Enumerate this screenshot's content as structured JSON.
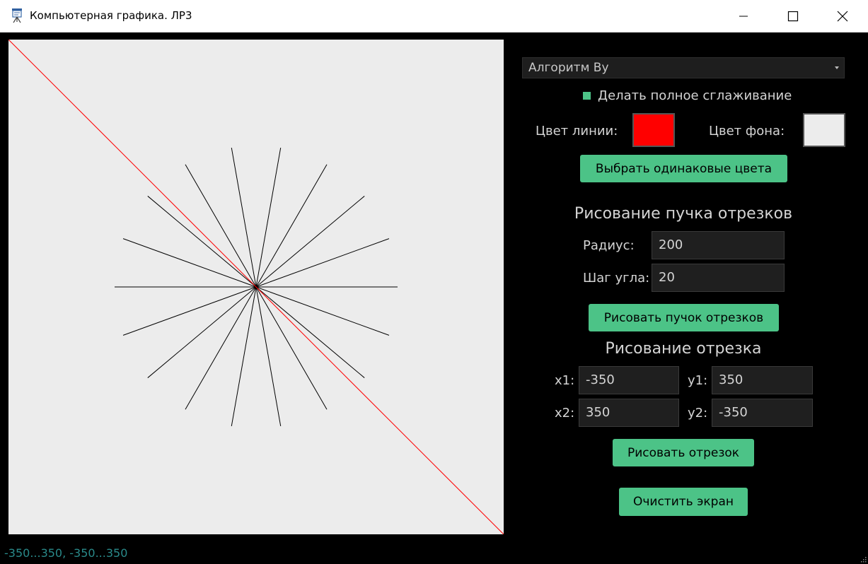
{
  "window": {
    "title": "Компьютерная графика. ЛР3",
    "minimize_icon": "minimize-icon",
    "maximize_icon": "maximize-icon",
    "close_icon": "close-icon"
  },
  "controls": {
    "algorithm": "Алгоритм Ву",
    "smoothing_label": "Делать полное сглаживание",
    "smoothing_checked": true,
    "line_color_label": "Цвет линии:",
    "line_color": "#ff0000",
    "bg_color_label": "Цвет фона:",
    "bg_color": "#ececec",
    "same_colors_button": "Выбрать одинаковые цвета"
  },
  "bundle": {
    "header": "Рисование пучка отрезков",
    "radius_label": "Радиус:",
    "radius_value": "200",
    "step_label": "Шаг угла:",
    "step_value": "20",
    "draw_button": "Рисовать пучок отрезков"
  },
  "segment": {
    "header": "Рисование отрезка",
    "x1_label": "x1:",
    "x1_value": "-350",
    "y1_label": "y1:",
    "y1_value": "350",
    "x2_label": "x2:",
    "x2_value": "350",
    "y2_label": "y2:",
    "y2_value": "-350",
    "draw_button": "Рисовать отрезок"
  },
  "clear_button": "Очистить экран",
  "status_text": "-350...350, -350...350",
  "colors": {
    "accent": "#4cc387",
    "ray_color": "#000000",
    "status_color": "#2a8a8a"
  }
}
